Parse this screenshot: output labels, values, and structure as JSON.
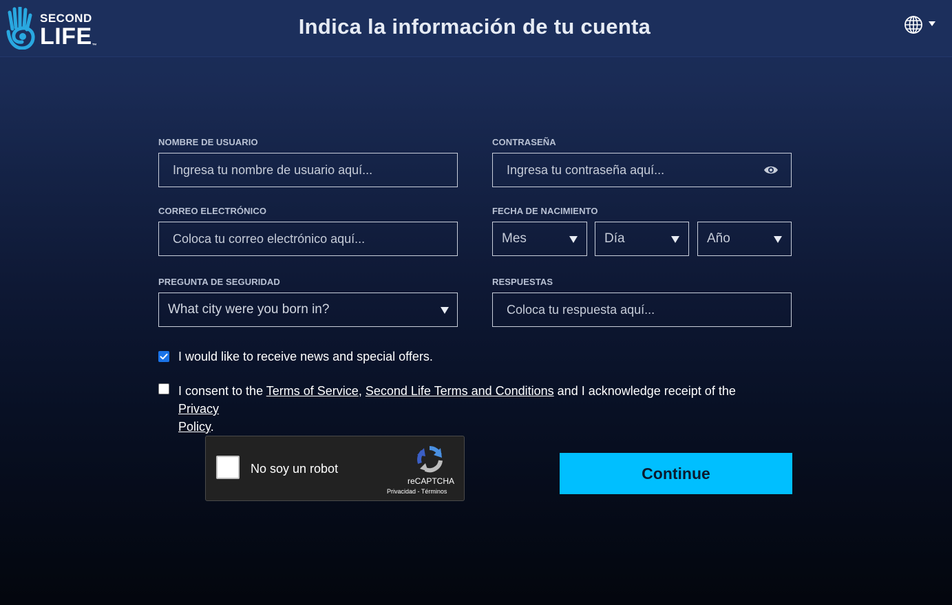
{
  "brand": {
    "line1": "SECOND",
    "line2": "LIFE",
    "tm": "™"
  },
  "header": {
    "title": "Indica la información de tu cuenta",
    "language_icon": "globe-icon"
  },
  "form": {
    "username": {
      "label": "NOMBRE DE USUARIO",
      "placeholder": "Ingresa tu nombre de usuario aquí...",
      "value": ""
    },
    "password": {
      "label": "CONTRASEÑA",
      "placeholder": "Ingresa tu contraseña aquí...",
      "value": "",
      "toggle_icon": "eye-icon"
    },
    "email": {
      "label": "CORREO ELECTRÓNICO",
      "placeholder": "Coloca tu correo electrónico aquí...",
      "value": ""
    },
    "birthdate": {
      "label": "FECHA DE NACIMIENTO",
      "month": "Mes",
      "day": "Día",
      "year": "Año"
    },
    "security_question": {
      "label": "PREGUNTA DE SEGURIDAD",
      "selected": "What city were you born in?"
    },
    "answer": {
      "label": "RESPUESTAS",
      "placeholder": "Coloca tu respuesta aquí...",
      "value": ""
    },
    "news_opt_in": {
      "checked": true,
      "label": "I would like to receive news and special offers."
    },
    "consent": {
      "checked": false,
      "text_1": "I consent to the ",
      "link_tos": "Terms of Service",
      "sep": ", ",
      "link_terms": "Second Life Terms and Conditions",
      "text_2": " and I acknowledge receipt of the ",
      "link_privacy_1": "Privacy",
      "link_privacy_2": "Policy",
      "end": "."
    }
  },
  "recaptcha": {
    "label": "No soy un robot",
    "brand": "reCAPTCHA",
    "privacy": "Privacidad",
    "dash": " - ",
    "terms": "Términos"
  },
  "continue_label": "Continue",
  "colors": {
    "header_bg": "#1c2f5c",
    "accent": "#00bfff",
    "logo_blue": "#29a8e0",
    "checkbox_blue": "#1a73e8"
  }
}
